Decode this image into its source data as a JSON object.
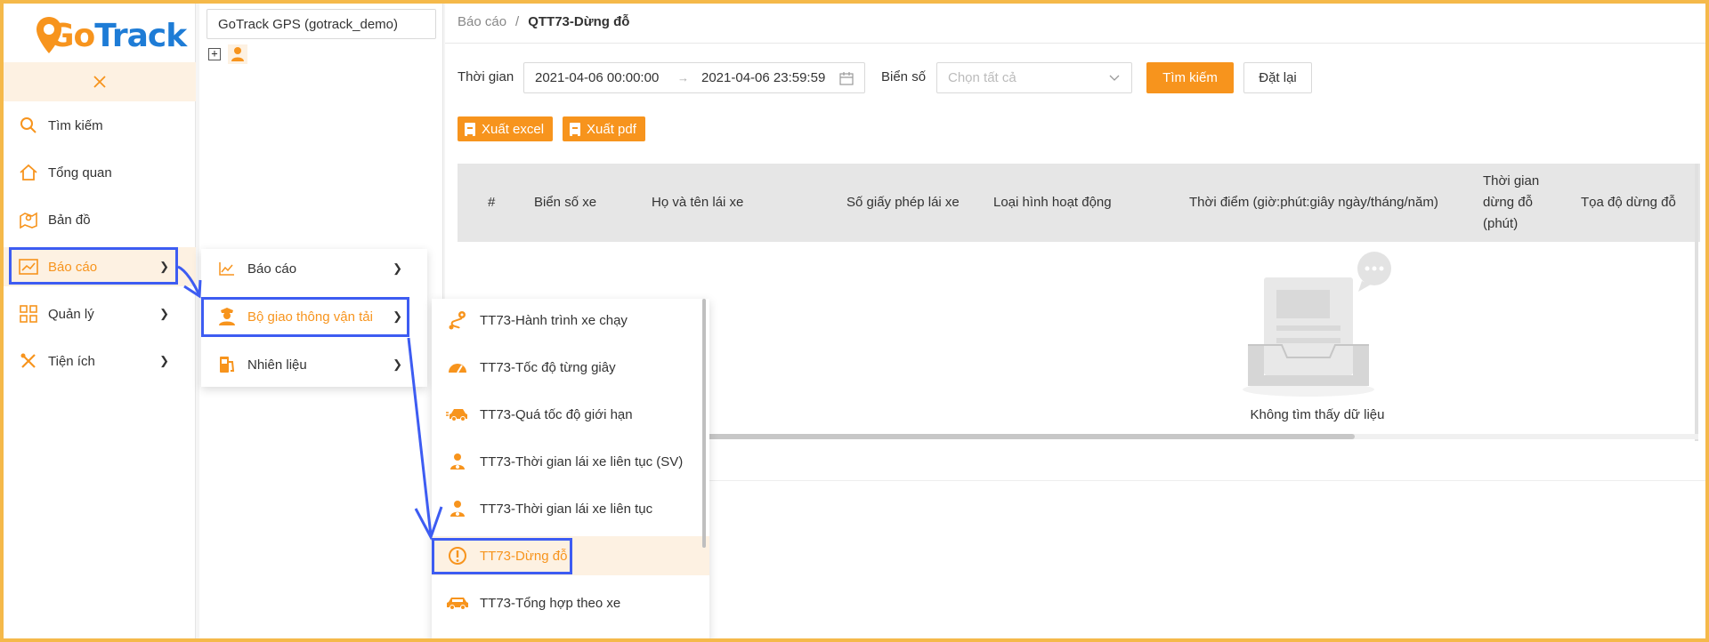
{
  "app": {
    "logo_go": "Go",
    "logo_track": "Track"
  },
  "sidebar": {
    "items": [
      {
        "label": "Tìm kiếm",
        "icon": "search-icon"
      },
      {
        "label": "Tổng quan",
        "icon": "home-icon"
      },
      {
        "label": "Bản đồ",
        "icon": "map-icon"
      },
      {
        "label": "Báo cáo",
        "icon": "chart-icon"
      },
      {
        "label": "Quản lý",
        "icon": "grid-icon"
      },
      {
        "label": "Tiện ích",
        "icon": "tools-icon"
      }
    ]
  },
  "tree": {
    "account": "GoTrack GPS (gotrack_demo)"
  },
  "breadcrumb": {
    "parent": "Báo cáo",
    "separator": "/",
    "current": "QTT73-Dừng đỗ"
  },
  "filters": {
    "time_label": "Thời gian",
    "date_from": "2021-04-06 00:00:00",
    "date_to": "2021-04-06 23:59:59",
    "plate_label": "Biển số",
    "plate_placeholder": "Chọn tất cả",
    "search_button": "Tìm kiếm",
    "reset_button": "Đặt lại"
  },
  "export": {
    "excel": "Xuất excel",
    "pdf": "Xuất pdf"
  },
  "table": {
    "columns": [
      "#",
      "Biển số xe",
      "Họ và tên lái xe",
      "Số giấy phép lái xe",
      "Loại hình hoạt động",
      "Thời điểm (giờ:phút:giây ngày/tháng/năm)",
      "Thời gian dừng đỗ (phút)",
      "Tọa độ dừng đỗ"
    ],
    "stop_time_lines": [
      "Thời gian",
      "dừng đỗ",
      "(phút)"
    ],
    "empty_text": "Không tìm thấy dữ liệu"
  },
  "report_menu": {
    "items": [
      {
        "label": "Báo cáo",
        "icon": "line-chart-icon"
      },
      {
        "label": "Bộ giao thông vận tải",
        "icon": "officer-icon"
      },
      {
        "label": "Nhiên liệu",
        "icon": "fuel-pump-icon"
      }
    ]
  },
  "ministry_menu": {
    "items": [
      {
        "label": "TT73-Hành trình xe chạy",
        "icon": "route-icon"
      },
      {
        "label": "TT73-Tốc độ từng giây",
        "icon": "speedometer-icon"
      },
      {
        "label": "TT73-Quá tốc độ giới hạn",
        "icon": "speeding-car-icon"
      },
      {
        "label": "TT73-Thời gian lái xe liên tục (SV)",
        "icon": "driver-icon"
      },
      {
        "label": "TT73-Thời gian lái xe liên tục",
        "icon": "driver-icon"
      },
      {
        "label": "TT73-Dừng đỗ",
        "icon": "alert-circle-icon"
      },
      {
        "label": "TT73-Tổng hợp theo xe",
        "icon": "car-icon"
      }
    ]
  },
  "colors": {
    "accent": "#f7941d",
    "brand_blue": "#1e7cd6",
    "highlight": "#3d5cf2",
    "frame": "#f5b94a"
  }
}
